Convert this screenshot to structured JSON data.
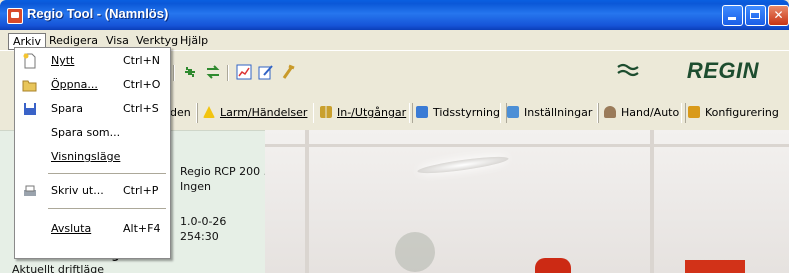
{
  "window": {
    "title": "Regio Tool - (Namnlös)"
  },
  "menubar": {
    "items": [
      {
        "label": "Arkiv",
        "active": true
      },
      {
        "label": "Redigera"
      },
      {
        "label": "Visa"
      },
      {
        "label": "Verktyg"
      },
      {
        "label": "Hjälp"
      }
    ]
  },
  "brand": {
    "name": "REGIN"
  },
  "tabs": [
    {
      "label": "den",
      "icon": "tab-icon"
    },
    {
      "label": "Larm/Händelser",
      "icon": "warning-icon"
    },
    {
      "label": "In-/Utgångar",
      "icon": "io-icon"
    },
    {
      "label": "Tidsstyrning",
      "icon": "clock-icon"
    },
    {
      "label": "Inställningar",
      "icon": "settings-icon"
    },
    {
      "label": "Hand/Auto",
      "icon": "hand-icon"
    },
    {
      "label": "Konfigurering",
      "icon": "config-icon"
    }
  ],
  "panel": {
    "lines": [
      "Regio RCP 200 ...",
      "Ingen",
      "1.0-0-26",
      "254:30"
    ],
    "heading": "Aktuellt driftläge",
    "subtext": "Aktuellt driftläge"
  },
  "dropdown": {
    "items": [
      {
        "label": "Nytt",
        "shortcut": "Ctrl+N",
        "icon": "new-file-icon"
      },
      {
        "label": "Öppna...",
        "shortcut": "Ctrl+O",
        "icon": "open-folder-icon"
      },
      {
        "label": "Spara",
        "shortcut": "Ctrl+S",
        "icon": "save-icon"
      },
      {
        "label": "Spara som...",
        "shortcut": "",
        "icon": ""
      },
      {
        "label": "Visningsläge",
        "shortcut": "",
        "icon": ""
      },
      {
        "label": "Skriv ut...",
        "shortcut": "Ctrl+P",
        "icon": "print-icon"
      },
      {
        "label": "Avsluta",
        "shortcut": "Alt+F4",
        "icon": ""
      }
    ]
  }
}
